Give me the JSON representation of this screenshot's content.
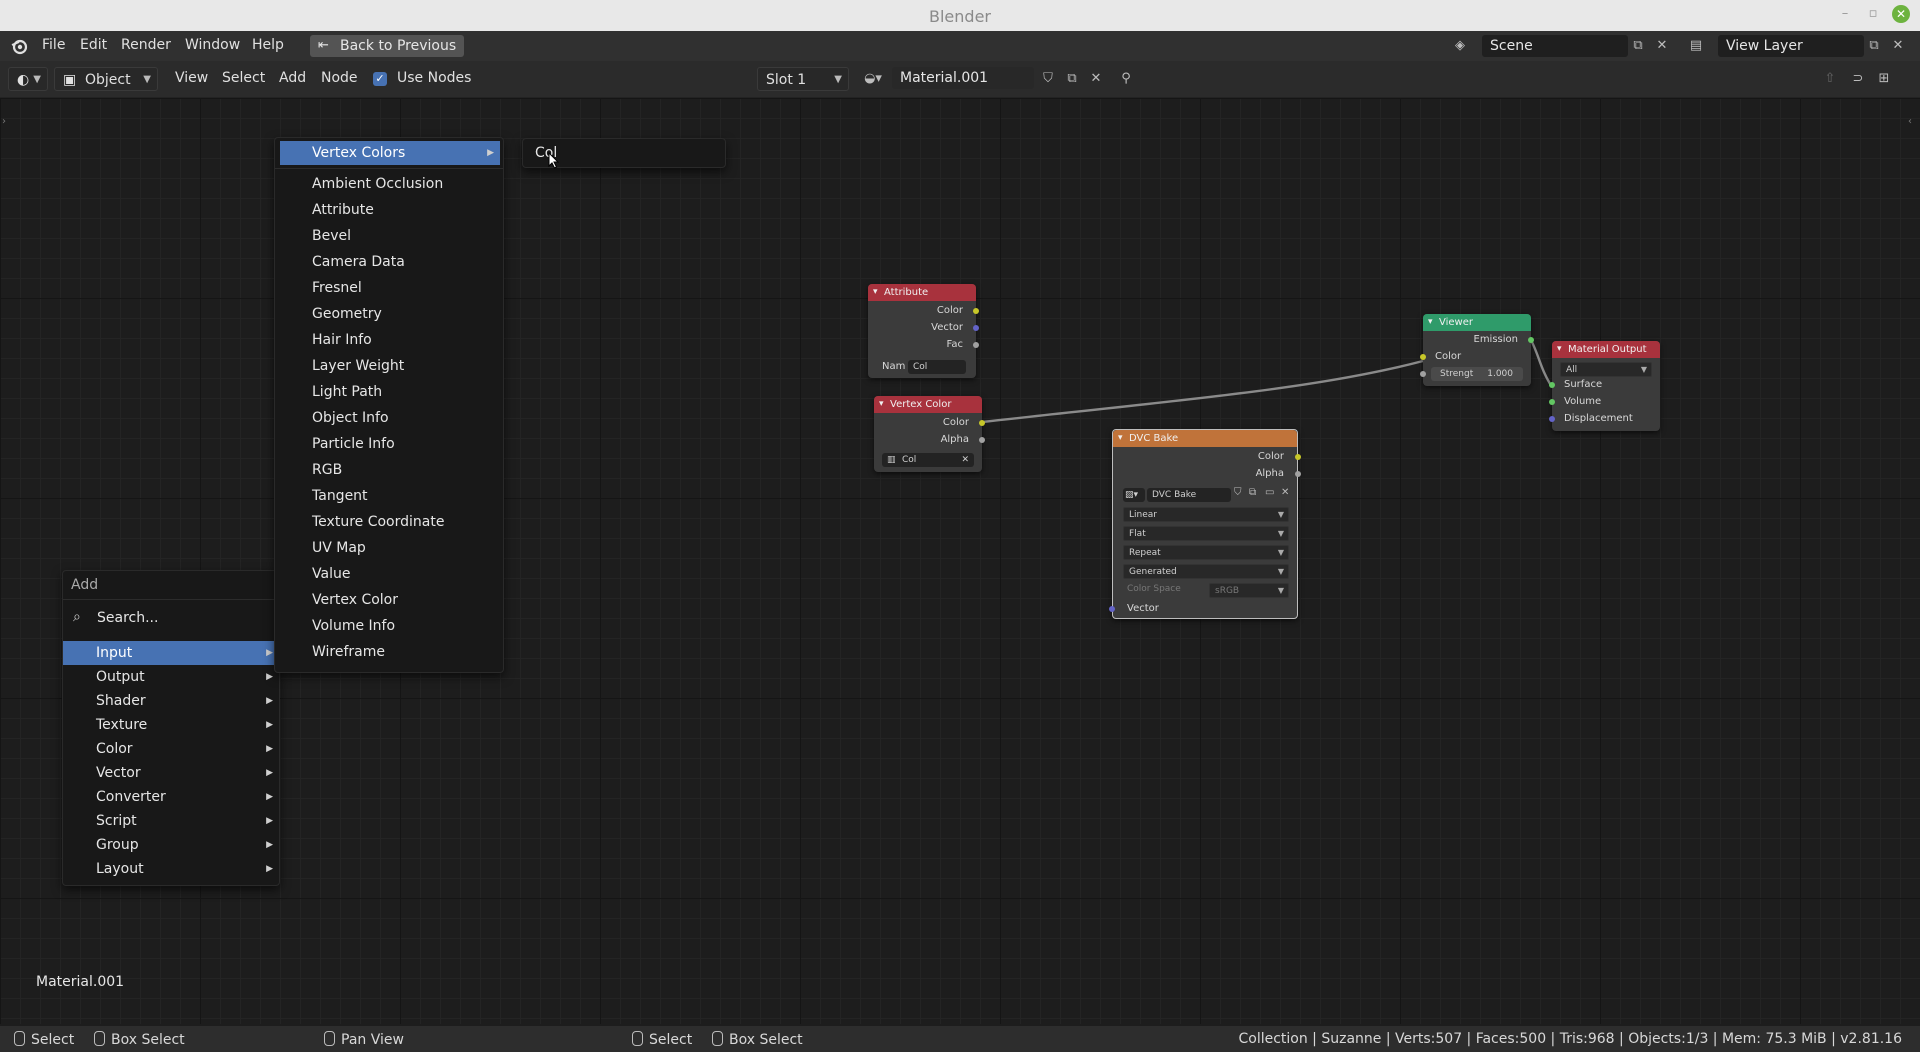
{
  "window": {
    "title": "Blender"
  },
  "topbar": {
    "menus": [
      "File",
      "Edit",
      "Render",
      "Window",
      "Help"
    ],
    "back_button": "Back to Previous",
    "scene": "Scene",
    "view_layer": "View Layer"
  },
  "header": {
    "mode": "Object",
    "menus": [
      "View",
      "Select",
      "Add",
      "Node"
    ],
    "use_nodes_label": "Use Nodes",
    "use_nodes_checked": true,
    "slot": "Slot 1",
    "material": "Material.001"
  },
  "nodes": {
    "attribute": {
      "title": "Attribute",
      "outputs": [
        "Color",
        "Vector",
        "Fac"
      ],
      "name_label": "Nam",
      "name_value": "Col"
    },
    "vertex_color": {
      "title": "Vertex Color",
      "outputs": [
        "Color",
        "Alpha"
      ],
      "layer": "Col"
    },
    "dvc_bake": {
      "title": "DVC Bake",
      "outputs": [
        "Color",
        "Alpha"
      ],
      "image": "DVC Bake",
      "interpolation": "Linear",
      "projection": "Flat",
      "extension": "Repeat",
      "source": "Generated",
      "color_space_label": "Color Space",
      "color_space": "sRGB",
      "input": "Vector"
    },
    "viewer": {
      "title": "Viewer",
      "output": "Emission",
      "input_color": "Color",
      "strength_label": "Strengt",
      "strength_value": "1.000"
    },
    "material_output": {
      "title": "Material Output",
      "target": "All",
      "inputs": [
        "Surface",
        "Volume",
        "Displacement"
      ]
    }
  },
  "add_menu": {
    "title": "Add",
    "search_placeholder": "Search...",
    "items": [
      "Input",
      "Output",
      "Shader",
      "Texture",
      "Color",
      "Vector",
      "Converter",
      "Script",
      "Group",
      "Layout"
    ],
    "selected_index": 0
  },
  "input_submenu": {
    "items": [
      "Vertex Colors",
      "Ambient Occlusion",
      "Attribute",
      "Bevel",
      "Camera Data",
      "Fresnel",
      "Geometry",
      "Hair Info",
      "Layer Weight",
      "Light Path",
      "Object Info",
      "Particle Info",
      "RGB",
      "Tangent",
      "Texture Coordinate",
      "UV Map",
      "Value",
      "Vertex Color",
      "Volume Info",
      "Wireframe"
    ],
    "selected_index": 0
  },
  "vertex_colors_submenu": {
    "items": [
      "Col"
    ]
  },
  "editor": {
    "material_label": "Material.001"
  },
  "statusbar": {
    "left": [
      "Select",
      "Box Select",
      "Pan View",
      "Select",
      "Box Select"
    ],
    "info": "Collection | Suzanne | Verts:507 | Faces:500 | Tris:968 | Objects:1/3 | Mem: 75.3 MiB | v2.81.16"
  },
  "colors": {
    "menu_highlight": "#4772b3",
    "input_node_header": "#a8323d",
    "texture_node_header": "#c0733a",
    "shader_node_header": "#2f9b6a",
    "socket_color": "#c7c729",
    "socket_vector": "#6363c7",
    "socket_float": "#a1a1a1",
    "socket_shader": "#63c763"
  }
}
